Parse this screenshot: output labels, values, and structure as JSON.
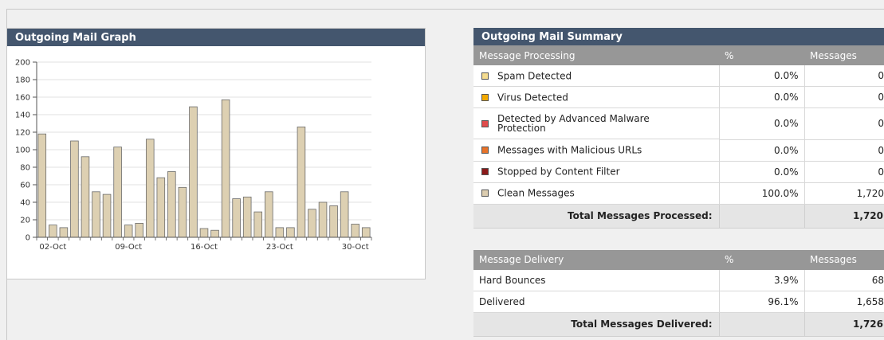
{
  "graph_panel": {
    "title": "Outgoing Mail Graph"
  },
  "chart_data": {
    "type": "bar",
    "title": "",
    "xlabel": "",
    "ylabel": "",
    "ylim": [
      0,
      200
    ],
    "yticks": [
      0,
      20,
      40,
      60,
      80,
      100,
      120,
      140,
      160,
      180,
      200
    ],
    "x_tick_labels": [
      "02-Oct",
      "09-Oct",
      "16-Oct",
      "23-Oct",
      "30-Oct"
    ],
    "x_tick_positions": [
      1,
      8,
      15,
      22,
      29
    ],
    "bar_color": "#ddd0b2",
    "bar_border_color": "#6b6b6b",
    "values": [
      118,
      14,
      11,
      110,
      92,
      52,
      49,
      103,
      14,
      16,
      112,
      68,
      75,
      57,
      149,
      10,
      8,
      157,
      44,
      46,
      29,
      52,
      11,
      11,
      126,
      32,
      40,
      36,
      52,
      15,
      11
    ],
    "grid": true
  },
  "summary_panel": {
    "title": "Outgoing Mail Summary",
    "processing": {
      "headers": [
        "Message Processing",
        "%",
        "Messages"
      ],
      "rows": [
        {
          "label": "Spam Detected",
          "pct": "0.0%",
          "count": "0",
          "color": "#f5dc8f"
        },
        {
          "label": "Virus Detected",
          "pct": "0.0%",
          "count": "0",
          "color": "#f2a900"
        },
        {
          "label": "Detected by Advanced Malware Protection",
          "pct": "0.0%",
          "count": "0",
          "color": "#e04b4b"
        },
        {
          "label": "Messages with Malicious URLs",
          "pct": "0.0%",
          "count": "0",
          "color": "#e8732a"
        },
        {
          "label": "Stopped by Content Filter",
          "pct": "0.0%",
          "count": "0",
          "color": "#8b1a1a"
        },
        {
          "label": "Clean Messages",
          "pct": "100.0%",
          "count": "1,720",
          "color": "#dccdb0"
        }
      ],
      "total_label": "Total Messages Processed:",
      "total_value": "1,720"
    },
    "delivery": {
      "headers": [
        "Message Delivery",
        "%",
        "Messages"
      ],
      "rows": [
        {
          "label": "Hard Bounces",
          "pct": "3.9%",
          "count": "68"
        },
        {
          "label": "Delivered",
          "pct": "96.1%",
          "count": "1,658"
        }
      ],
      "total_label": "Total Messages Delivered:",
      "total_value": "1,726"
    }
  }
}
